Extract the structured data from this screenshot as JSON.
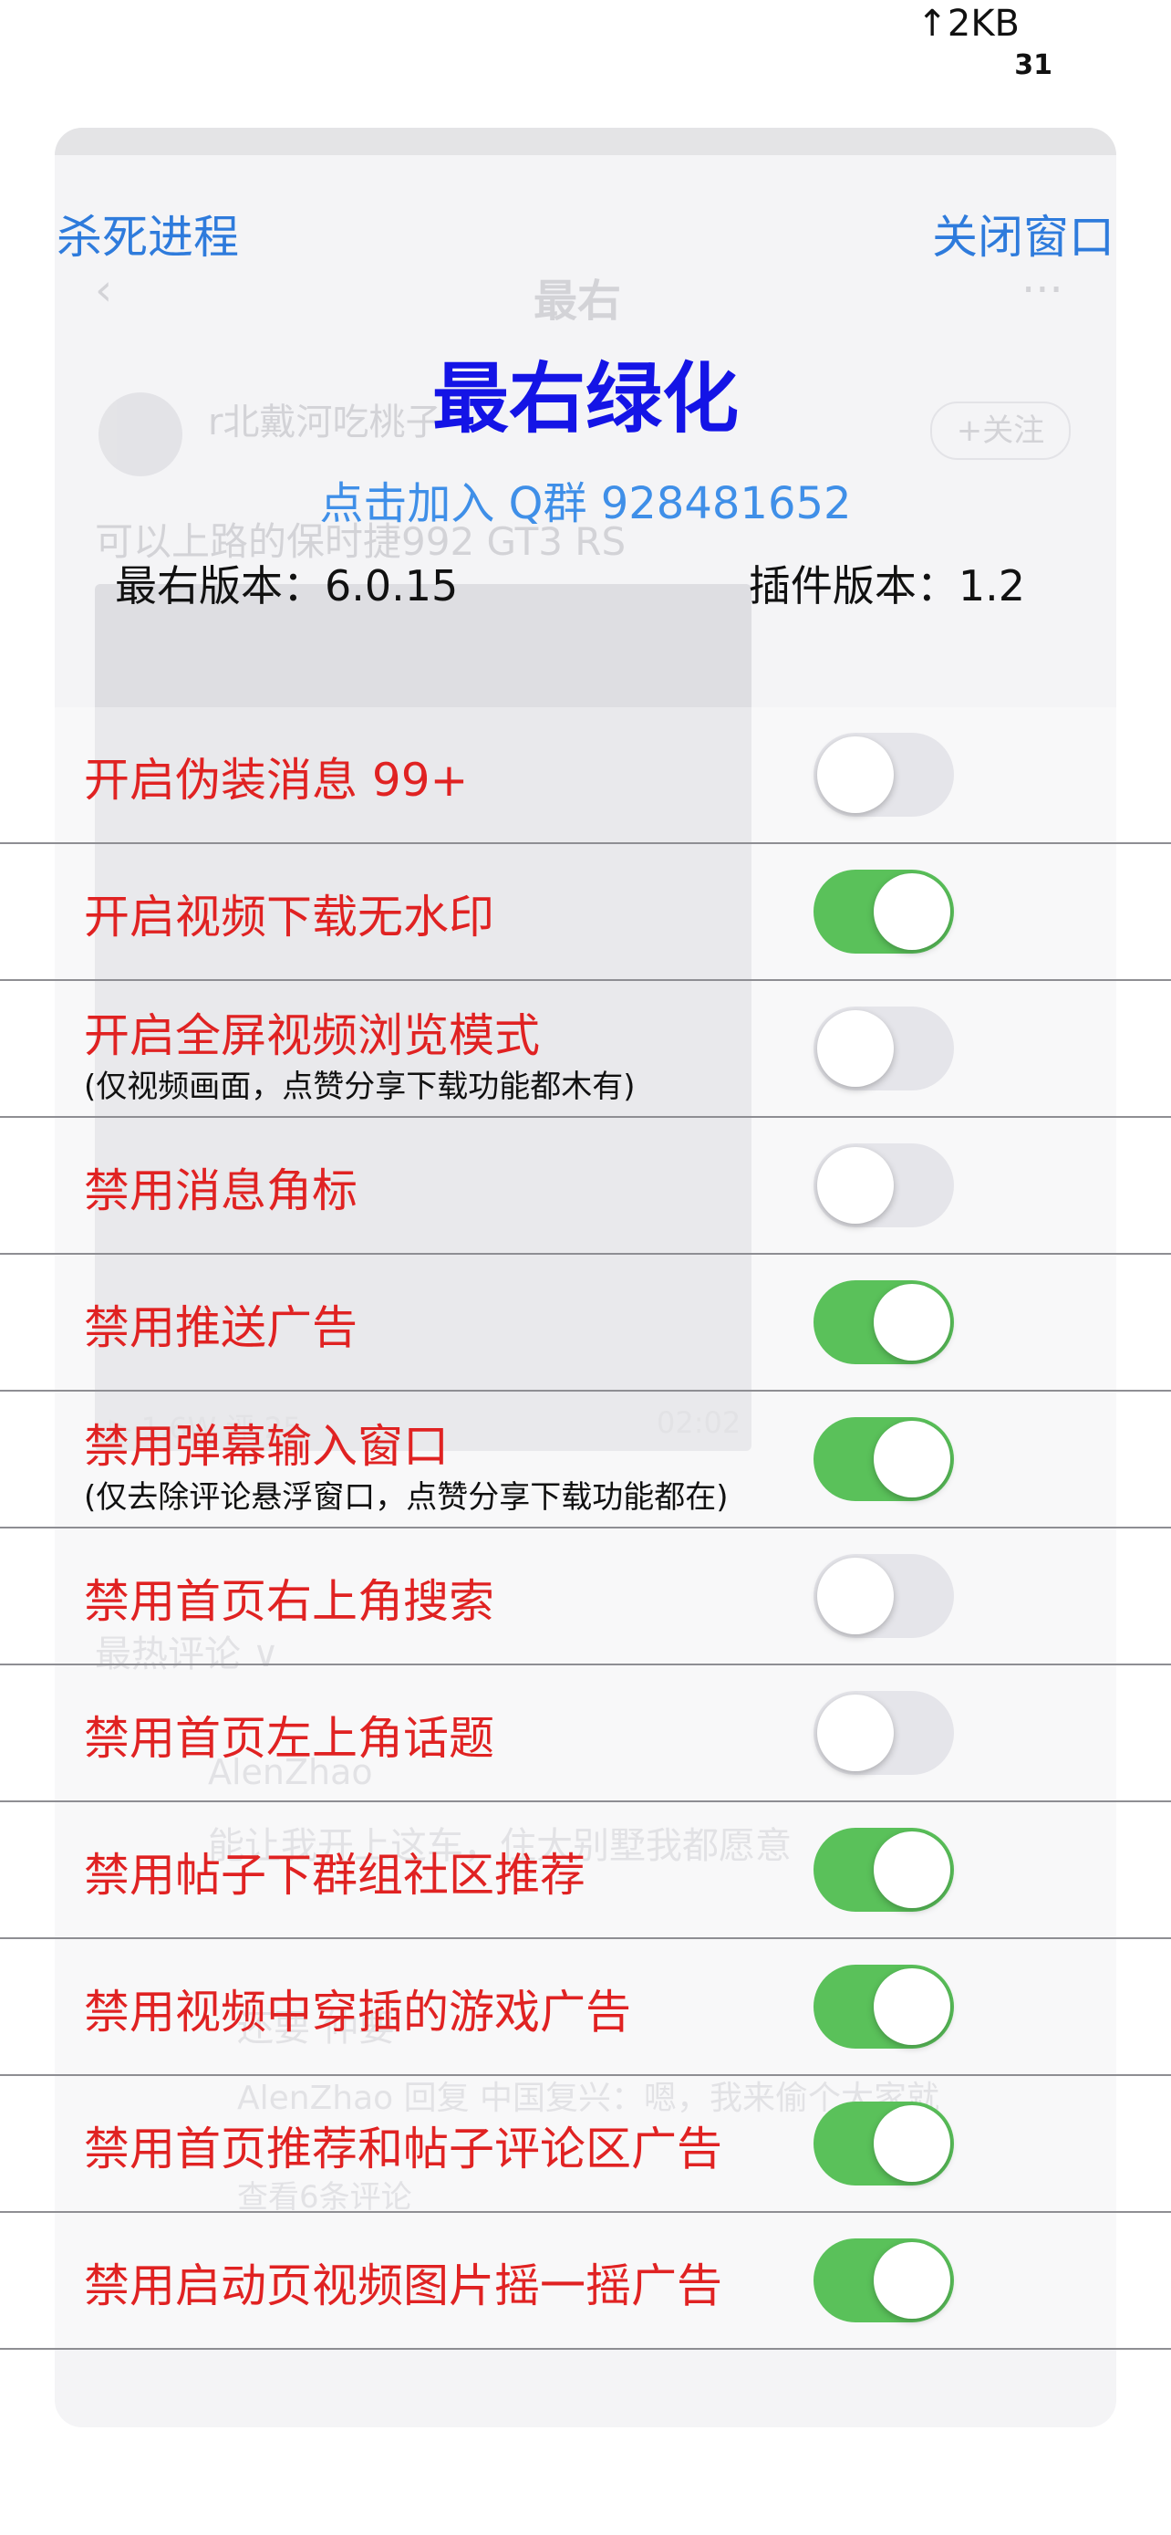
{
  "status_bar": {
    "net_speed": "↑2KB",
    "net_sub": "31"
  },
  "background_app": {
    "back_icon": "‹",
    "title": "最右",
    "more_icon": "···",
    "user": "r北戴河吃桃子",
    "follow": "+关注",
    "post_text": "可以上路的保时捷992 GT3 RS",
    "video_stats": "▷ 1.6W 评 25",
    "video_time": "02:02",
    "hot_comments": "最热评论 ∨",
    "commenter": "AlenZhao",
    "comment": "能让我开上这车，住大别墅我都愿意",
    "reply_line": "还要 仲要",
    "reply": "AlenZhao 回复 中国复兴：嗯，我来偷个大家就",
    "view_more": "查看6条评论"
  },
  "overlay": {
    "kill_process": "杀死进程",
    "close_window": "关闭窗口",
    "brand": "最右绿化",
    "join_qq": "点击加入 Q群 928481652",
    "app_version": "最右版本：6.0.15",
    "plugin_version": "插件版本：1.2"
  },
  "settings": [
    {
      "label": "开启伪装消息 99+",
      "note": "",
      "on": false
    },
    {
      "label": "开启视频下载无水印",
      "note": "",
      "on": true
    },
    {
      "label": "开启全屏视频浏览模式",
      "note": "(仅视频画面，点赞分享下载功能都木有)",
      "on": false
    },
    {
      "label": "禁用消息角标",
      "note": "",
      "on": false
    },
    {
      "label": "禁用推送广告",
      "note": "",
      "on": true
    },
    {
      "label": "禁用弹幕输入窗口",
      "note": "(仅去除评论悬浮窗口，点赞分享下载功能都在)",
      "on": true
    },
    {
      "label": "禁用首页右上角搜索",
      "note": "",
      "on": false
    },
    {
      "label": "禁用首页左上角话题",
      "note": "",
      "on": false
    },
    {
      "label": "禁用帖子下群组社区推荐",
      "note": "",
      "on": true
    },
    {
      "label": "禁用视频中穿插的游戏广告",
      "note": "",
      "on": true
    },
    {
      "label": "禁用首页推荐和帖子评论区广告",
      "note": "",
      "on": true
    },
    {
      "label": "禁用启动页视频图片摇一摇广告",
      "note": "",
      "on": true
    }
  ],
  "colors": {
    "toggle_on": "#5ac15a",
    "toggle_off": "#e5e5ea",
    "label_red": "#e02222",
    "link_blue": "#2e7bdc",
    "brand_blue": "#1414e6"
  }
}
